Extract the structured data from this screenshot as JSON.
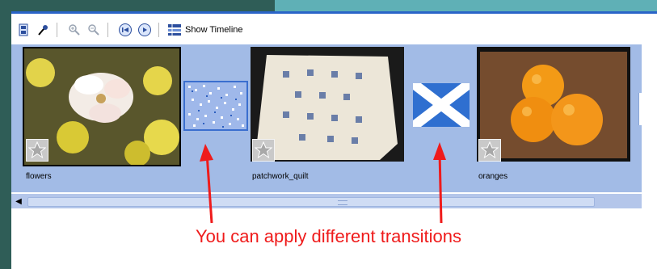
{
  "toolbar": {
    "show_timeline_label": "Show Timeline",
    "icons": [
      "storyboard-icon",
      "audio-icon",
      "zoom-in-icon",
      "zoom-out-icon",
      "rewind-icon",
      "play-icon",
      "timeline-icon"
    ]
  },
  "storyboard": {
    "clips": [
      {
        "name": "flowers"
      },
      {
        "name": "patchwork_quilt"
      },
      {
        "name": "oranges"
      }
    ],
    "transitions": [
      "transition-noise-icon",
      "transition-cross-icon"
    ]
  },
  "annotation": {
    "caption": "You can apply different transitions",
    "color": "#ef1b1b"
  },
  "colors": {
    "storyboard_bg": "#a2bbe6",
    "frame_dark": "#2f5d57",
    "frame_accent": "#5fb0b6"
  }
}
